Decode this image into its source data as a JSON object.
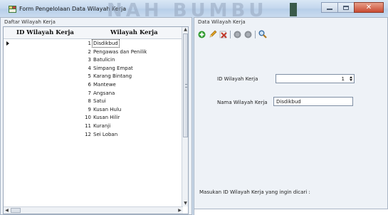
{
  "window": {
    "title": "Form Pengelolaan Data Wilayah Kerja",
    "watermark": "NAH BUMBU"
  },
  "left_panel": {
    "group_title": "Daftar Wilayah Kerja",
    "columns": [
      "ID Wilayah Kerja",
      "Wilayah Kerja"
    ],
    "rows": [
      {
        "id": "1",
        "name": "Disdikbud"
      },
      {
        "id": "2",
        "name": "Pengawas dan Penilik"
      },
      {
        "id": "3",
        "name": "Batulicin"
      },
      {
        "id": "4",
        "name": "Simpang Empat"
      },
      {
        "id": "5",
        "name": "Karang Bintang"
      },
      {
        "id": "6",
        "name": "Mantewe"
      },
      {
        "id": "7",
        "name": "Angsana"
      },
      {
        "id": "8",
        "name": "Satui"
      },
      {
        "id": "9",
        "name": "Kusan Hulu"
      },
      {
        "id": "10",
        "name": "Kusan Hilir"
      },
      {
        "id": "11",
        "name": "Kuranji"
      },
      {
        "id": "12",
        "name": "Sei Loban"
      }
    ],
    "selected_row": 0
  },
  "right_panel": {
    "group_title": "Data Wilayah Kerja",
    "toolbar": [
      "add-icon",
      "edit-icon",
      "delete-icon",
      "save-icon",
      "cancel-icon",
      "search-icon"
    ],
    "id_label": "ID Wilayah Kerja",
    "id_value": "1",
    "name_label": "Nama Wilayah Kerja",
    "name_value": "Disdikbud",
    "search_prompt": "Masukan ID Wilayah Kerja yang ingin dicari :"
  },
  "colors": {
    "add": "#2e9a2e",
    "delete": "#c0392b",
    "edit_pencil": "#e0a020",
    "disabled": "#8a8f96",
    "search_lens": "#3a6ea5"
  }
}
